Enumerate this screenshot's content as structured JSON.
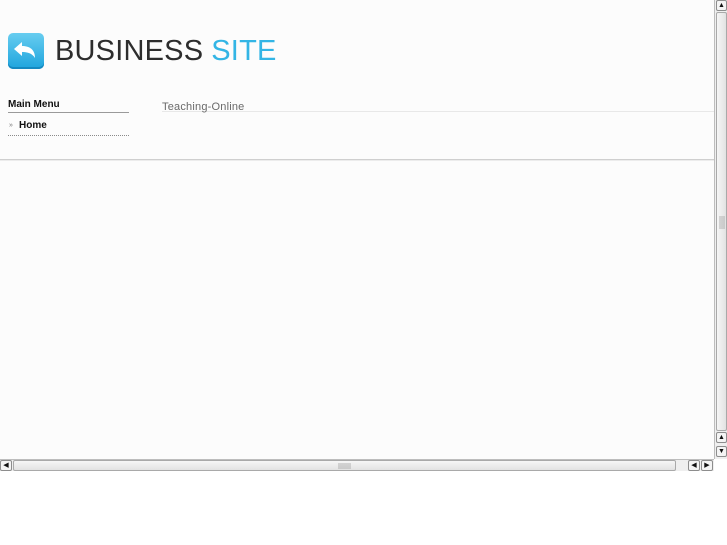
{
  "header": {
    "logo_icon": "arrow-return-icon",
    "logo_word1": "BUSINESS",
    "logo_word2": "SITE",
    "colors": {
      "brand_dark": "#2d2d2d",
      "brand_accent": "#33b5e5"
    }
  },
  "sidebar": {
    "title": "Main Menu",
    "items": [
      {
        "label": "Home",
        "icon": "double-chevron-right-icon"
      }
    ]
  },
  "main": {
    "heading": "Teaching-Online"
  },
  "scrollbars": {
    "up_glyph": "▲",
    "down_glyph": "▼",
    "left_glyph": "◀",
    "right_glyph": "▶"
  }
}
